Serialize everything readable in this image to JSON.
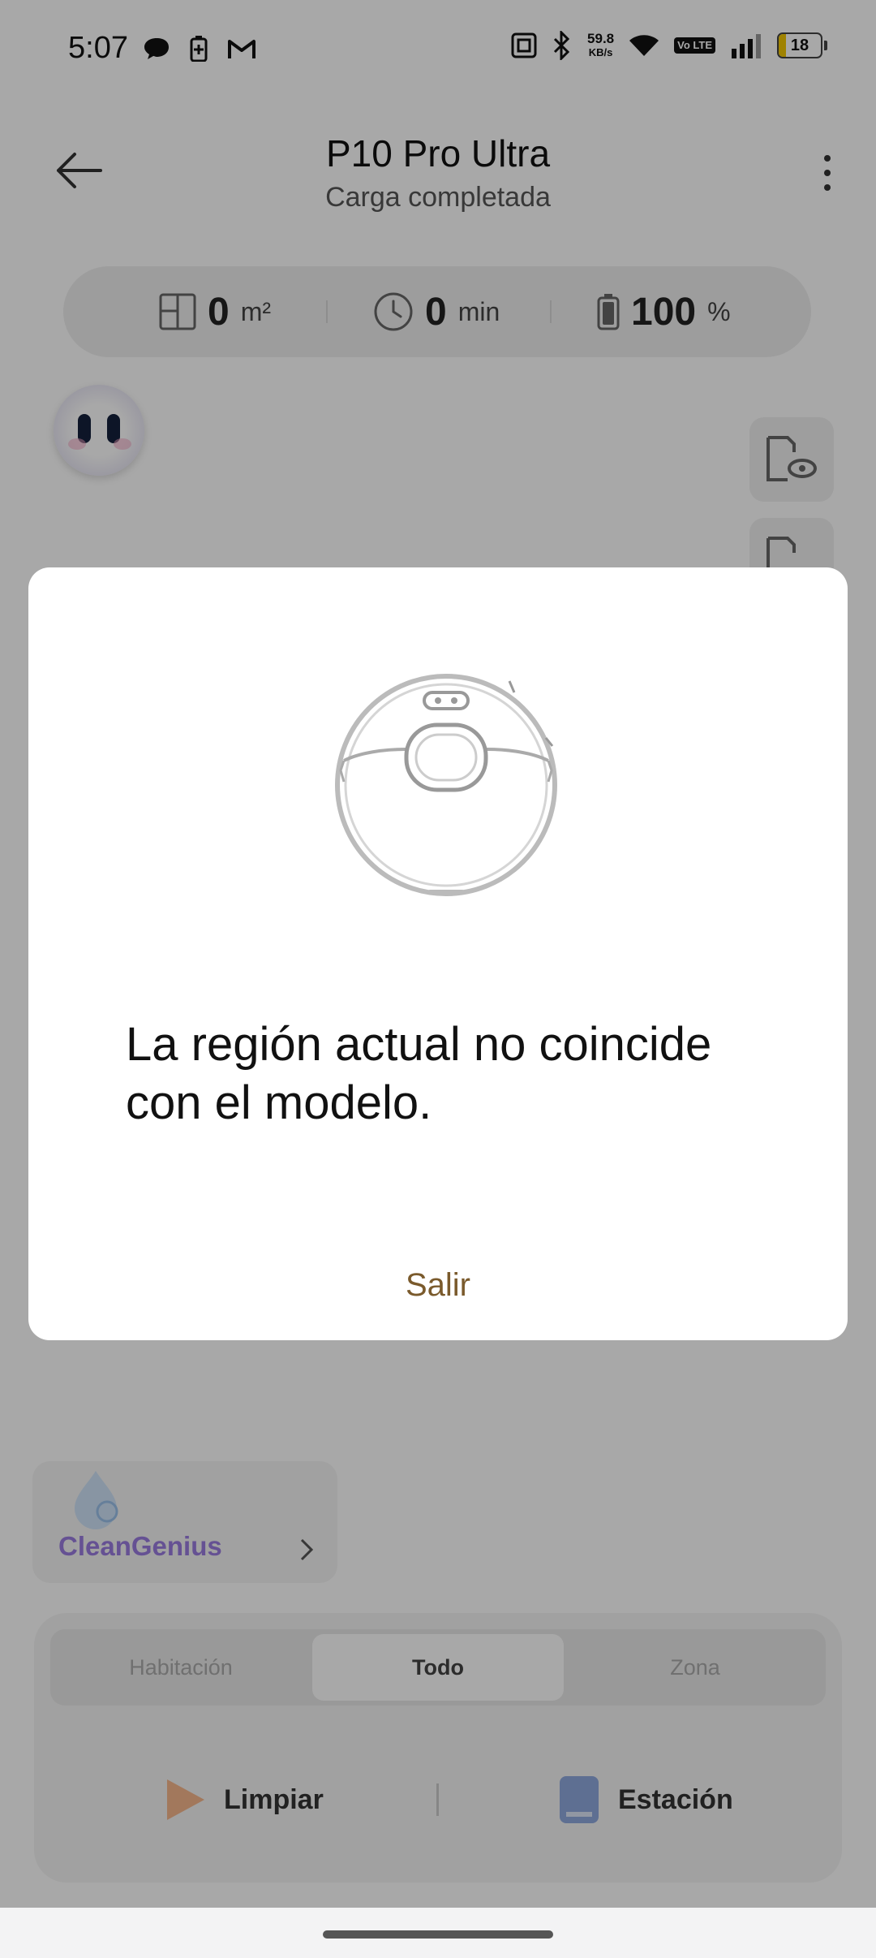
{
  "status_bar": {
    "time": "5:07",
    "speed_value": "59.8",
    "speed_unit": "KB/s",
    "volte": "Vo LTE",
    "battery_level": "18",
    "battery_fraction": 0.18,
    "icons": [
      "chat-bubble-icon",
      "battery-saver-icon",
      "gmail-icon",
      "nfc-icon",
      "bluetooth-icon",
      "wifi-icon",
      "volte-icon",
      "signal-icon",
      "battery-icon"
    ]
  },
  "header": {
    "title": "P10 Pro Ultra",
    "subtitle": "Carga completada"
  },
  "stats": {
    "area": {
      "value": "0",
      "unit": "m²"
    },
    "time": {
      "value": "0",
      "unit": "min"
    },
    "battery": {
      "value": "100",
      "unit": "%"
    }
  },
  "cleangenius": {
    "label": "CleanGenius"
  },
  "mode_tabs": [
    "Habitación",
    "Todo",
    "Zona"
  ],
  "selected_mode": "Todo",
  "actions": {
    "clean": "Limpiar",
    "station": "Estación"
  },
  "dialog": {
    "message": "La región actual no coincide con el modelo.",
    "exit_button": "Salir"
  },
  "colors": {
    "accent": "#7a5a2c",
    "cleangenius": "#9a7be0",
    "overlay": "rgba(0,0,0,0.34)"
  }
}
